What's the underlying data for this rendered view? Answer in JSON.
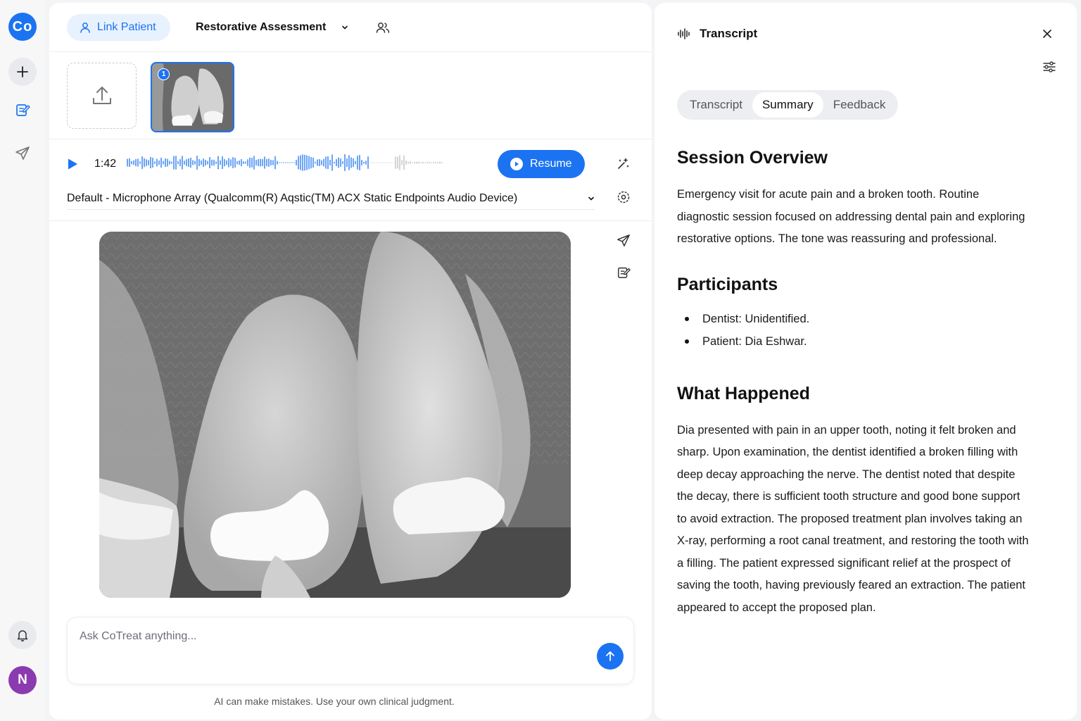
{
  "sidebar": {
    "logo_text": "Co",
    "avatar_initial": "N"
  },
  "header": {
    "link_patient_label": "Link Patient",
    "assessment_label": "Restorative Assessment"
  },
  "thumbnails": {
    "badge": "1"
  },
  "audio": {
    "time": "1:42",
    "resume_label": "Resume",
    "device": "Default - Microphone Array (Qualcomm(R) Aqstic(TM) ACX Static Endpoints Audio Device)"
  },
  "chat": {
    "placeholder": "Ask CoTreat anything...",
    "disclaimer": "AI can make mistakes. Use your own clinical judgment."
  },
  "transcript_panel": {
    "title": "Transcript",
    "tabs": [
      "Transcript",
      "Summary",
      "Feedback"
    ],
    "active_tab": "Summary",
    "sections": {
      "overview_title": "Session Overview",
      "overview_text": "Emergency visit for acute pain and a broken tooth. Routine diagnostic session focused on addressing dental pain and exploring restorative options. The tone was reassuring and professional.",
      "participants_title": "Participants",
      "participants": [
        "Dentist: Unidentified.",
        "Patient: Dia Eshwar."
      ],
      "happened_title": "What Happened",
      "happened_text": "Dia presented with pain in an upper tooth, noting it felt broken and sharp. Upon examination, the dentist identified a broken filling with deep decay approaching the nerve. The dentist noted that despite the decay, there is sufficient tooth structure and good bone support to avoid extraction. The proposed treatment plan involves taking an X-ray, performing a root canal treatment, and restoring the tooth with a filling. The patient expressed significant relief at the prospect of saving the tooth, having previously feared an extraction. The patient appeared to accept the proposed plan."
    }
  },
  "colors": {
    "accent": "#1b73f2",
    "avatar": "#8c3ab0"
  }
}
